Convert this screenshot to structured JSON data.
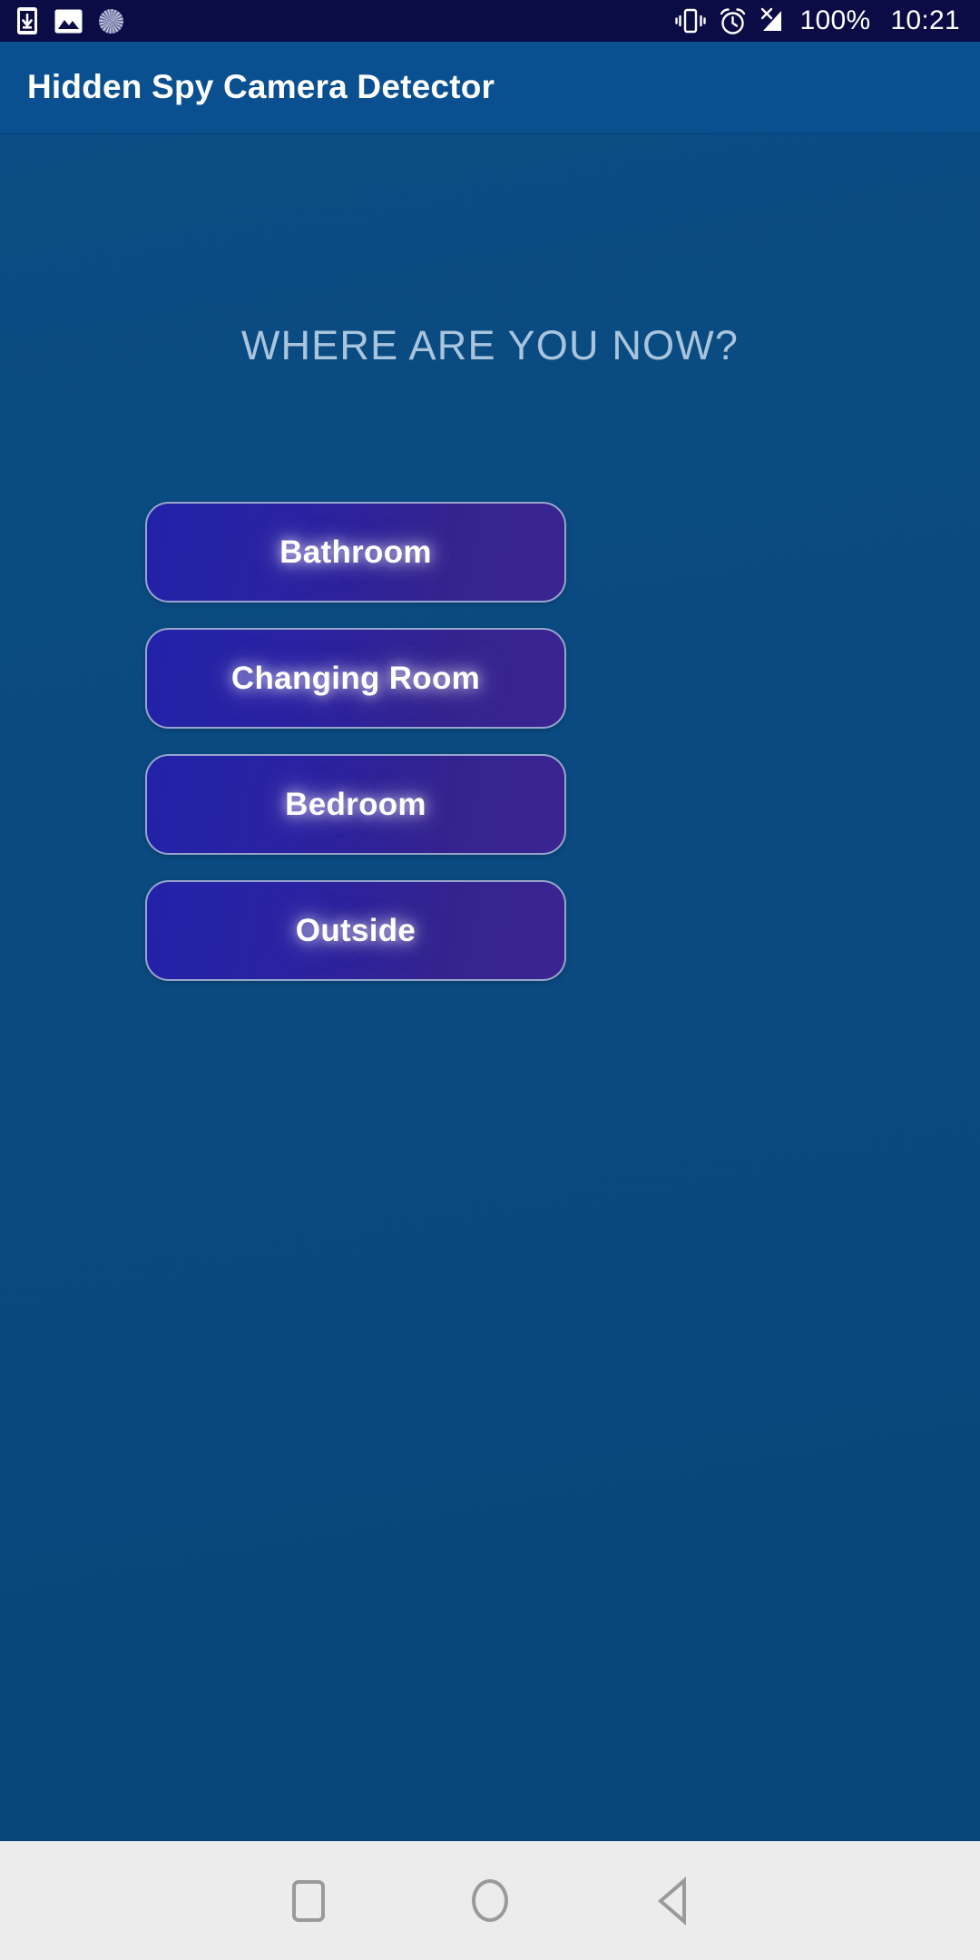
{
  "status_bar": {
    "left_icons": [
      {
        "name": "phone-download-icon",
        "glyph": "phone-download"
      },
      {
        "name": "image-gallery-icon",
        "glyph": "image"
      },
      {
        "name": "sync-spinner-icon",
        "glyph": "spinner"
      }
    ],
    "right_icons": [
      {
        "name": "vibrate-icon",
        "glyph": "vibrate"
      },
      {
        "name": "alarm-clock-icon",
        "glyph": "alarm"
      },
      {
        "name": "no-signal-icon",
        "glyph": "signal-off"
      }
    ],
    "battery": "100%",
    "time": "10:21",
    "background_color": "#0b0b45",
    "text_color": "#ffffff"
  },
  "app_bar": {
    "title": "Hidden Spy Camera Detector",
    "background_color": "#0a5090",
    "title_color": "#ffffff"
  },
  "main": {
    "heading": "WHERE ARE YOU NOW?",
    "heading_color": "#a9c5dd",
    "background_color": "#0a4a80",
    "choices": [
      {
        "id": "bathroom",
        "label": "Bathroom"
      },
      {
        "id": "changing-room",
        "label": "Changing Room"
      },
      {
        "id": "bedroom",
        "label": "Bedroom"
      },
      {
        "id": "outside",
        "label": "Outside"
      }
    ],
    "button_gradient_start": "#2222a8",
    "button_gradient_end": "#3a2590",
    "button_border_color": "#97a5cd",
    "button_text_color": "#ffffff"
  },
  "nav_bar": {
    "background_color": "#ececed",
    "icon_color": "#9a9a9a",
    "buttons": [
      {
        "id": "recents",
        "name": "recent-apps-icon"
      },
      {
        "id": "home",
        "name": "home-circle-icon"
      },
      {
        "id": "back",
        "name": "back-triangle-icon"
      }
    ]
  }
}
